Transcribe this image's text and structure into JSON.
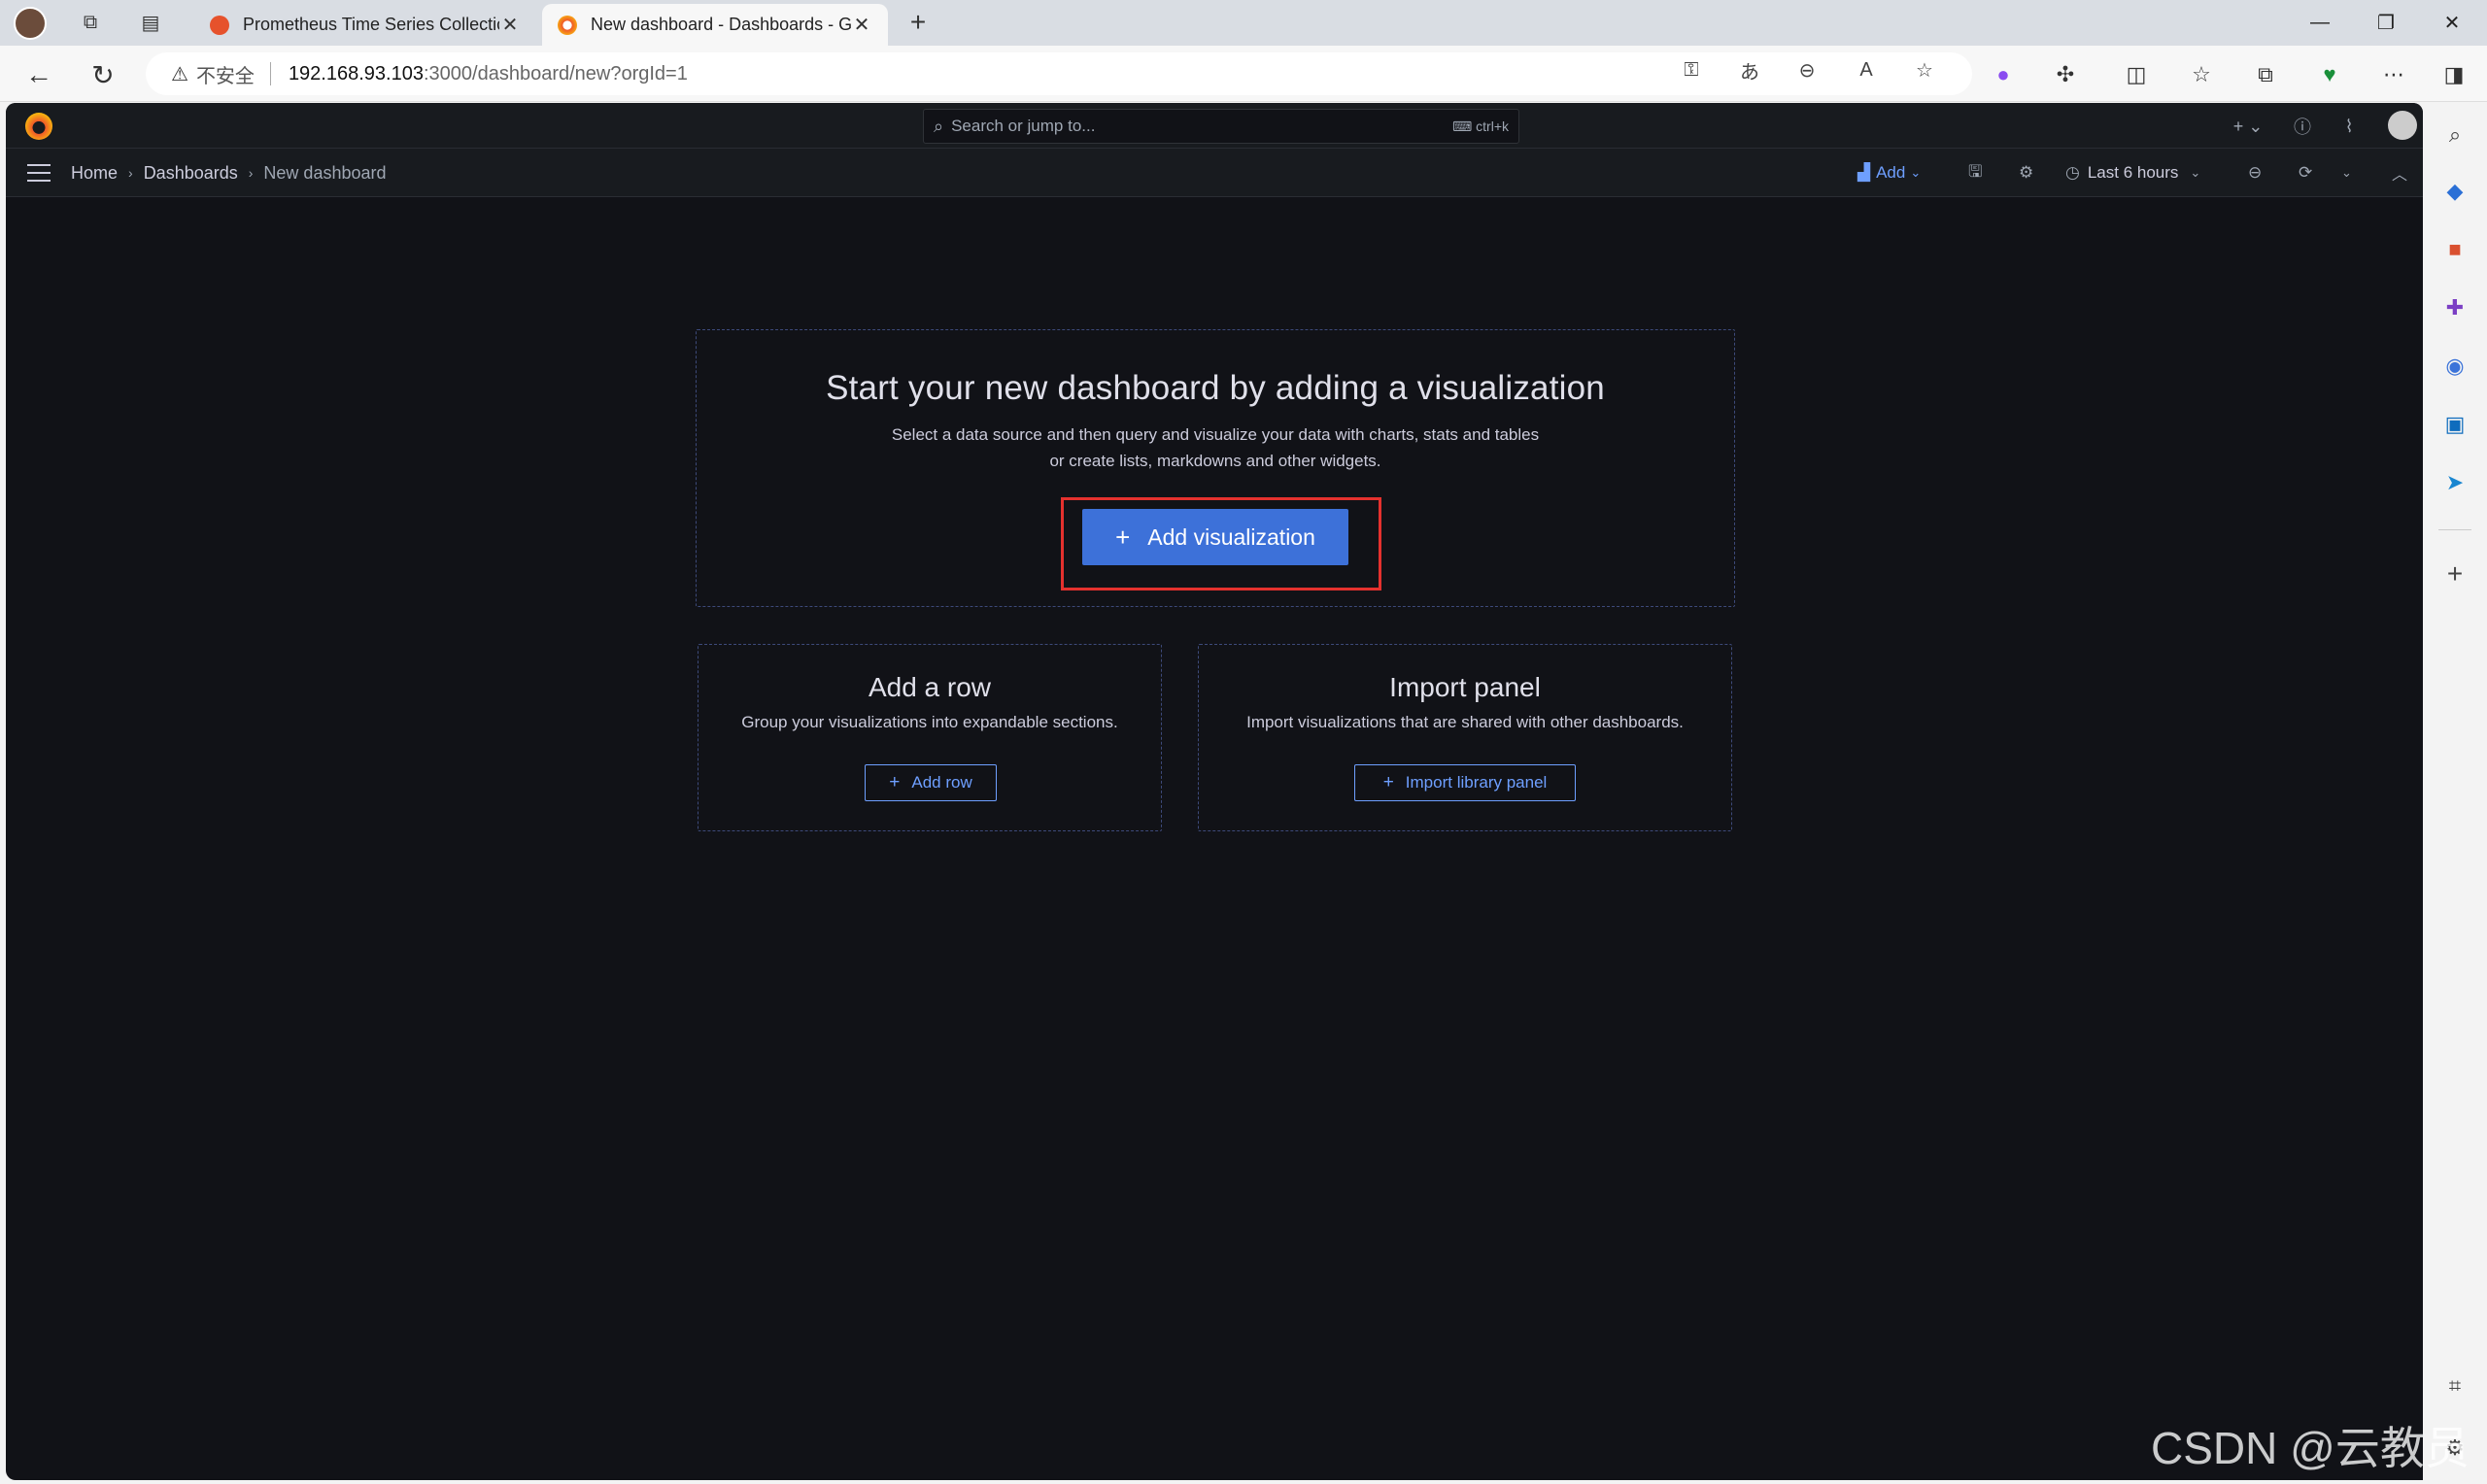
{
  "browser": {
    "tabs": [
      {
        "title": "Prometheus Time Series Collectio",
        "active": false
      },
      {
        "title": "New dashboard - Dashboards - G",
        "active": true
      }
    ],
    "address": {
      "security_label": "不安全",
      "host": "192.168.93.103",
      "path": ":3000/dashboard/new?orgId=1"
    }
  },
  "grafana": {
    "search": {
      "placeholder": "Search or jump to...",
      "shortcut": "ctrl+k"
    },
    "breadcrumbs": [
      "Home",
      "Dashboards",
      "New dashboard"
    ],
    "toolbar": {
      "add_label": "Add",
      "time_range": "Last 6 hours"
    },
    "empty_state": {
      "title": "Start your new dashboard by adding a visualization",
      "description_line1": "Select a data source and then query and visualize your data with charts, stats and tables",
      "description_line2": "or create lists, markdowns and other widgets.",
      "button_label": "Add visualization"
    },
    "add_row": {
      "title": "Add a row",
      "description": "Group your visualizations into expandable sections.",
      "button_label": "Add row"
    },
    "import_panel": {
      "title": "Import panel",
      "description": "Import visualizations that are shared with other dashboards.",
      "button_label": "Import library panel"
    }
  },
  "watermark": "CSDN @云教员"
}
